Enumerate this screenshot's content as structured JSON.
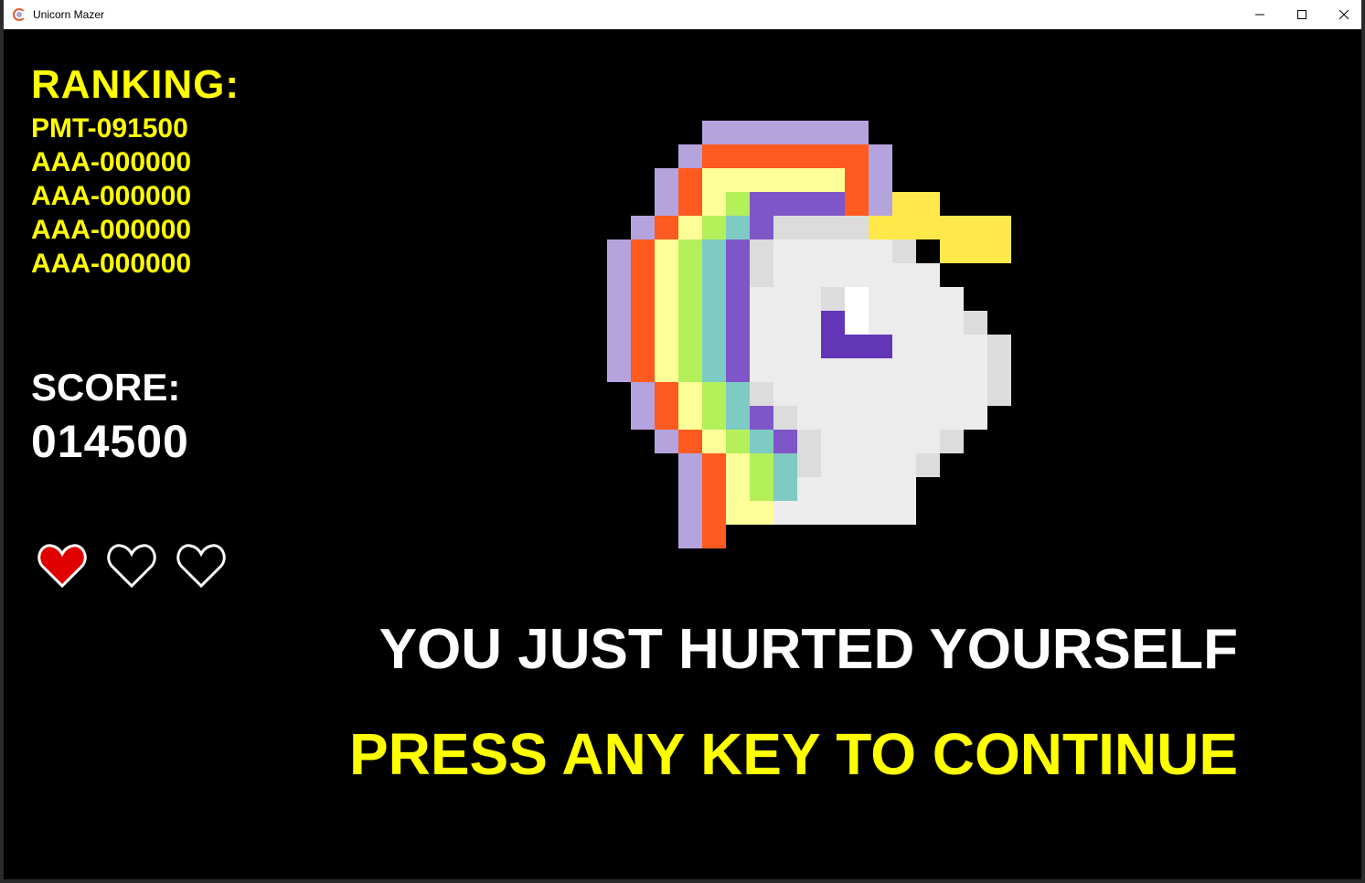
{
  "window": {
    "title": "Unicorn Mazer"
  },
  "ranking": {
    "title": "RANKING:",
    "entries": [
      "PMT-091500",
      "AAA-000000",
      "AAA-000000",
      "AAA-000000",
      "AAA-000000"
    ]
  },
  "score": {
    "label": "SCORE:",
    "value": "014500"
  },
  "lives": {
    "total": 3,
    "remaining": 1
  },
  "message": "YOU JUST HURTED YOURSELF",
  "prompt": "PRESS ANY KEY TO CONTINUE",
  "colors": {
    "background": "#000000",
    "highlight": "#ffff00",
    "text": "#ffffff",
    "heart_full": "#e00000"
  },
  "icons": {
    "app": "unicorn-app-icon",
    "minimize": "minimize-icon",
    "maximize": "maximize-icon",
    "close": "close-icon",
    "heart": "heart-icon",
    "unicorn": "pixel-unicorn-head"
  }
}
